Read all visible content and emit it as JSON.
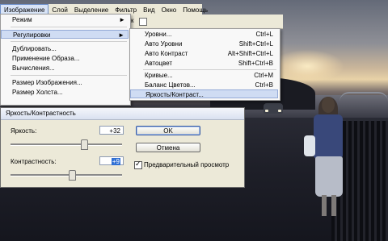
{
  "menubar": {
    "items": [
      "Изображение",
      "Слой",
      "Выделение",
      "Фильтр",
      "Вид",
      "Окно",
      "Помощь"
    ]
  },
  "image_menu": {
    "items": [
      {
        "label": "Режим",
        "submenu": true
      },
      {
        "label": "Регулировки",
        "submenu": true,
        "highlighted": true
      },
      {
        "label": "Дублировать..."
      },
      {
        "label": "Применение Образа..."
      },
      {
        "label": "Вычисления..."
      },
      {
        "label": "Размер Изображения..."
      },
      {
        "label": "Размер Холста..."
      }
    ],
    "arrow": "►"
  },
  "adjust_menu": {
    "items": [
      {
        "label": "Уровни...",
        "shortcut": "Ctrl+L"
      },
      {
        "label": "Авто Уровни",
        "shortcut": "Shift+Ctrl+L"
      },
      {
        "label": "Авто Контраст",
        "shortcut": "Alt+Shift+Ctrl+L"
      },
      {
        "label": "Автоцвет",
        "shortcut": "Shift+Ctrl+B"
      },
      {
        "label": "Кривые...",
        "shortcut": "Ctrl+M"
      },
      {
        "label": "Баланс Цветов...",
        "shortcut": "Ctrl+B"
      },
      {
        "label": "Яркость/Контраст...",
        "shortcut": "",
        "highlighted": true
      }
    ]
  },
  "toolstrip": {
    "fragment": "к"
  },
  "dialog": {
    "title": "Яркость/Контрастность",
    "brightness_label": "Яркость:",
    "brightness_value": "+32",
    "brightness_level": 0.66,
    "contrast_label": "Контрастность:",
    "contrast_value": "+9",
    "contrast_level": 0.55,
    "ok_label": "OK",
    "cancel_label": "Отмена",
    "preview_label": "Предварительный просмотр",
    "preview_checked": true
  }
}
